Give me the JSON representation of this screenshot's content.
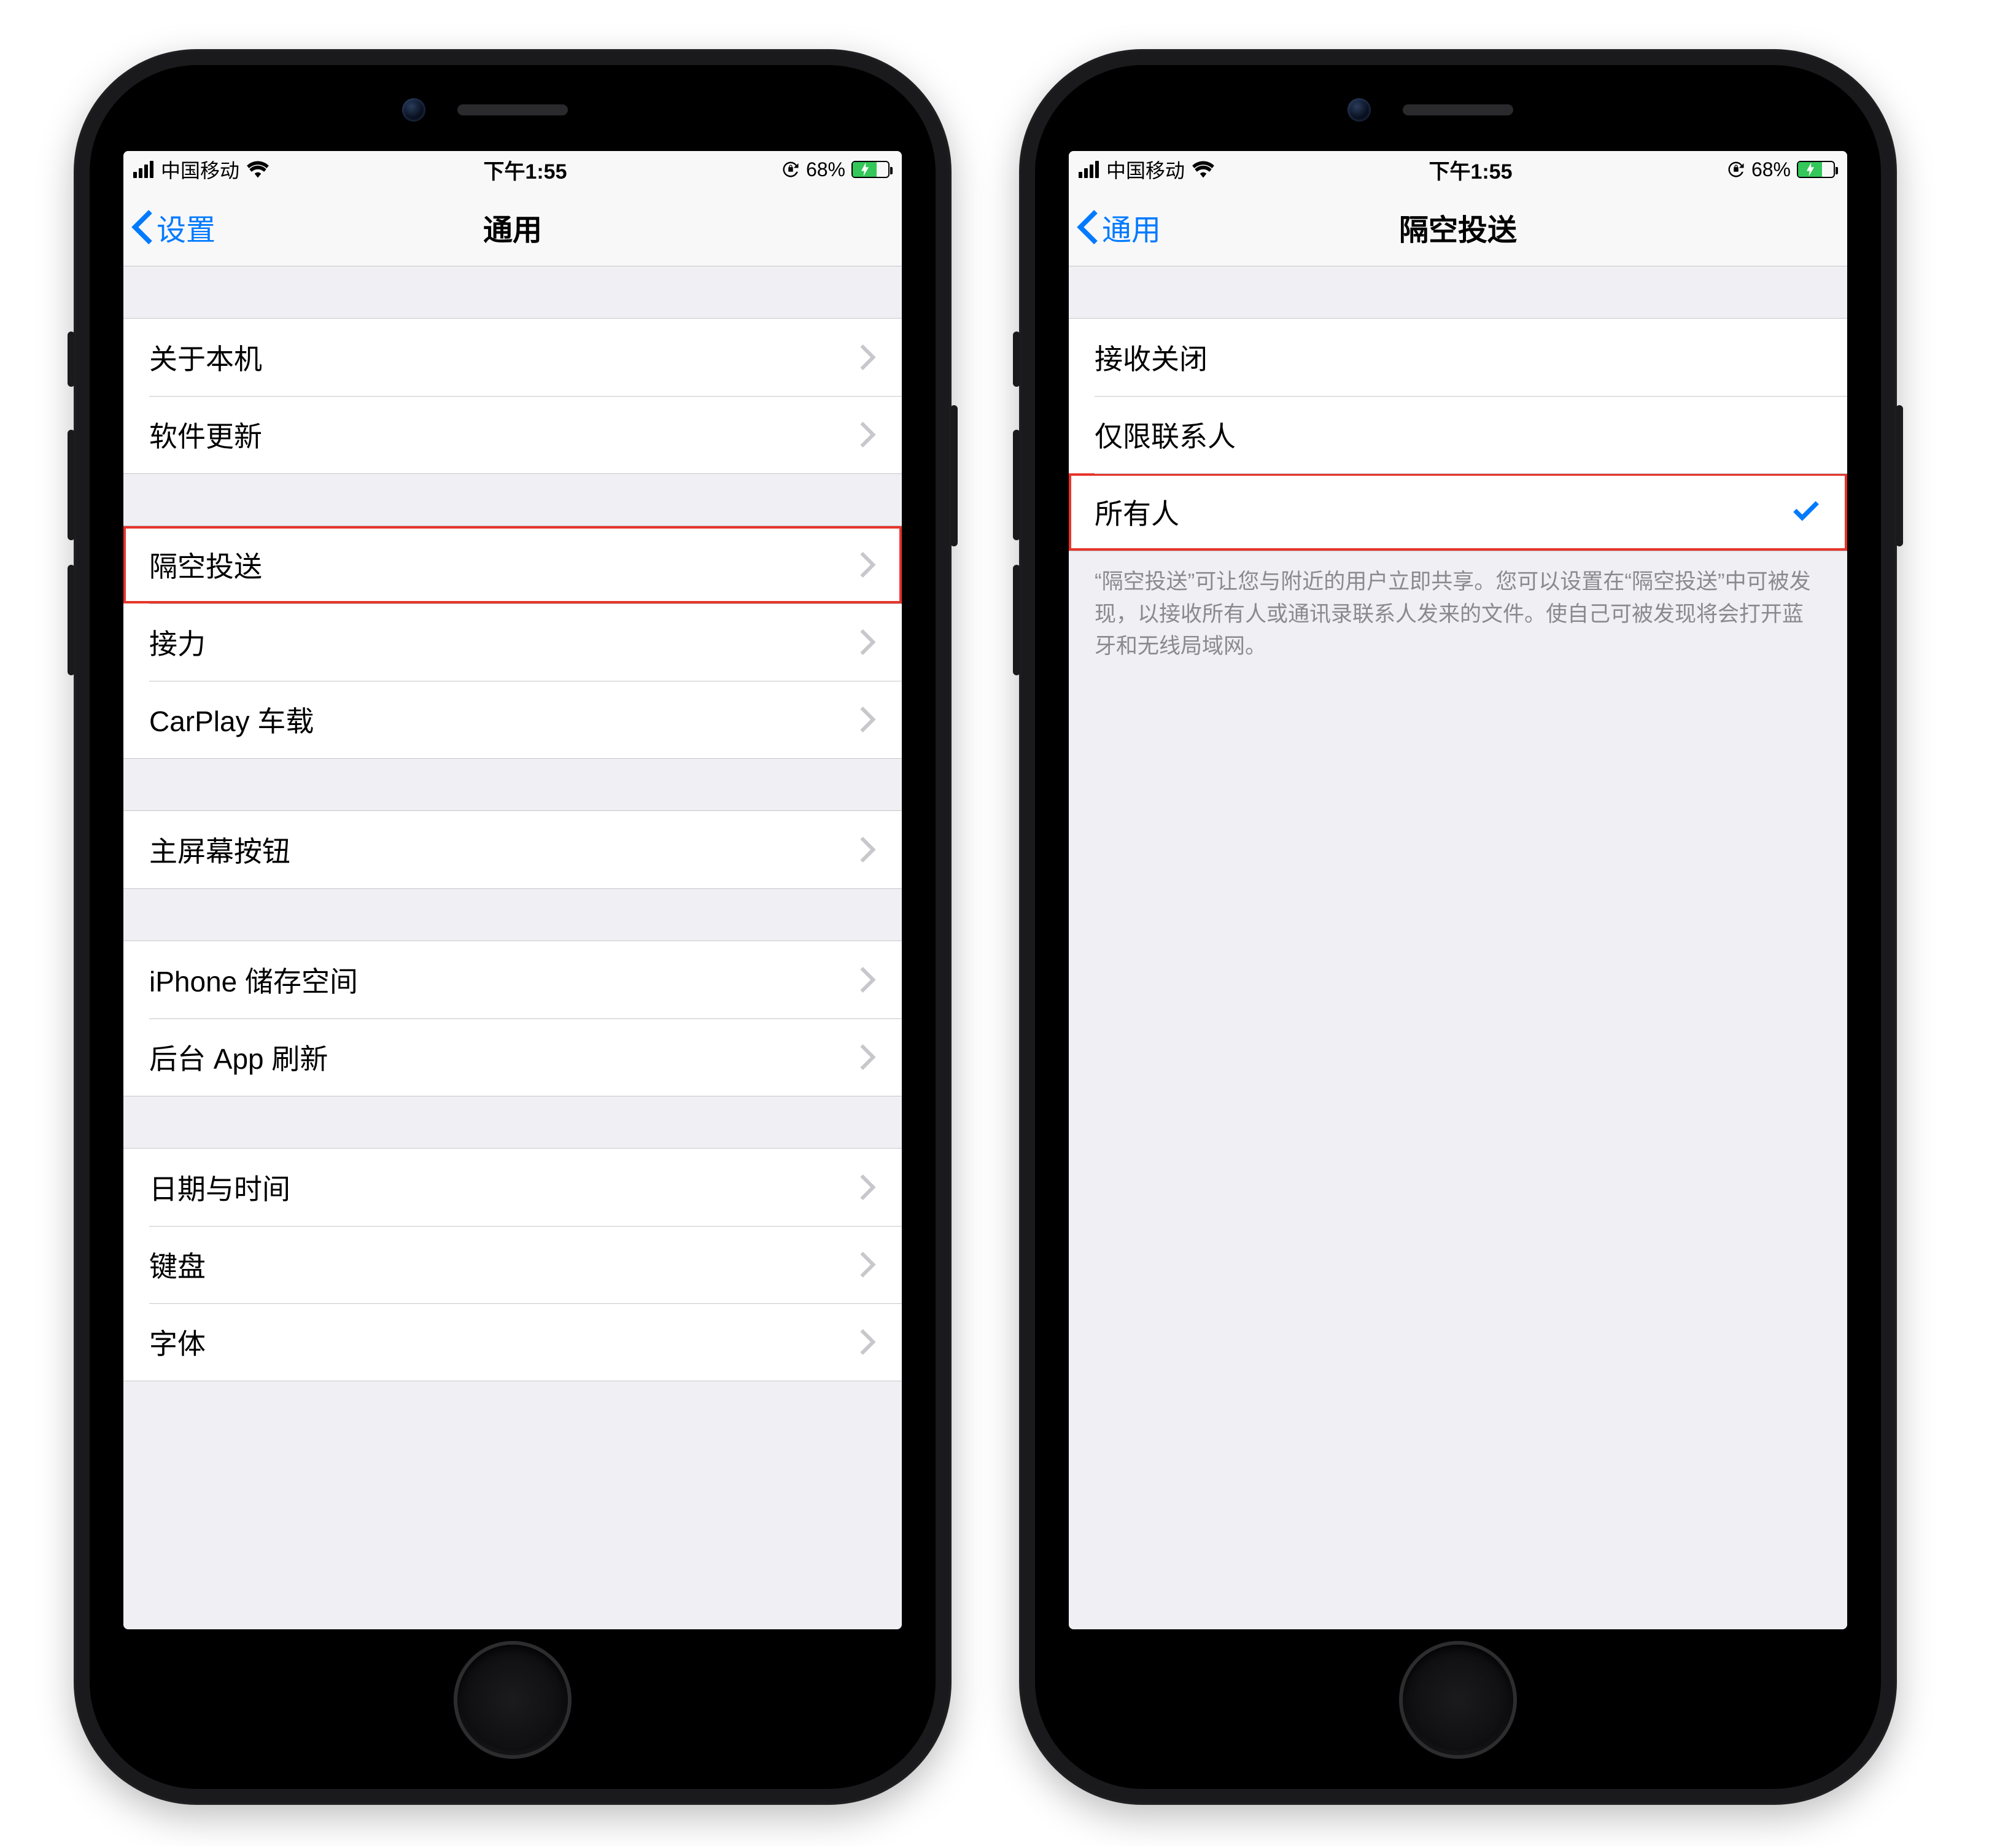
{
  "status": {
    "carrier": "中国移动",
    "time": "下午1:55",
    "battery_pct": "68%",
    "battery_fill_pct": 68
  },
  "left": {
    "back_label": "设置",
    "title": "通用",
    "groups": [
      {
        "rows": [
          {
            "label": "关于本机",
            "name": "row-about"
          },
          {
            "label": "软件更新",
            "name": "row-software-update"
          }
        ]
      },
      {
        "rows": [
          {
            "label": "隔空投送",
            "name": "row-airdrop",
            "highlight": true
          },
          {
            "label": "接力",
            "name": "row-handoff"
          },
          {
            "label": "CarPlay 车载",
            "name": "row-carplay"
          }
        ]
      },
      {
        "rows": [
          {
            "label": "主屏幕按钮",
            "name": "row-home-button"
          }
        ]
      },
      {
        "rows": [
          {
            "label": "iPhone 储存空间",
            "name": "row-storage"
          },
          {
            "label": "后台 App 刷新",
            "name": "row-background-refresh"
          }
        ]
      },
      {
        "rows": [
          {
            "label": "日期与时间",
            "name": "row-date-time"
          },
          {
            "label": "键盘",
            "name": "row-keyboard"
          },
          {
            "label": "字体",
            "name": "row-fonts"
          }
        ]
      }
    ]
  },
  "right": {
    "back_label": "通用",
    "title": "隔空投送",
    "rows": [
      {
        "label": "接收关闭",
        "name": "row-receiving-off",
        "checked": false
      },
      {
        "label": "仅限联系人",
        "name": "row-contacts-only",
        "checked": false
      },
      {
        "label": "所有人",
        "name": "row-everyone",
        "checked": true,
        "highlight": true
      }
    ],
    "footer": "“隔空投送”可让您与附近的用户立即共享。您可以设置在“隔空投送”中可被发现，以接收所有人或通讯录联系人发来的文件。使自己可被发现将会打开蓝牙和无线局域网。"
  }
}
